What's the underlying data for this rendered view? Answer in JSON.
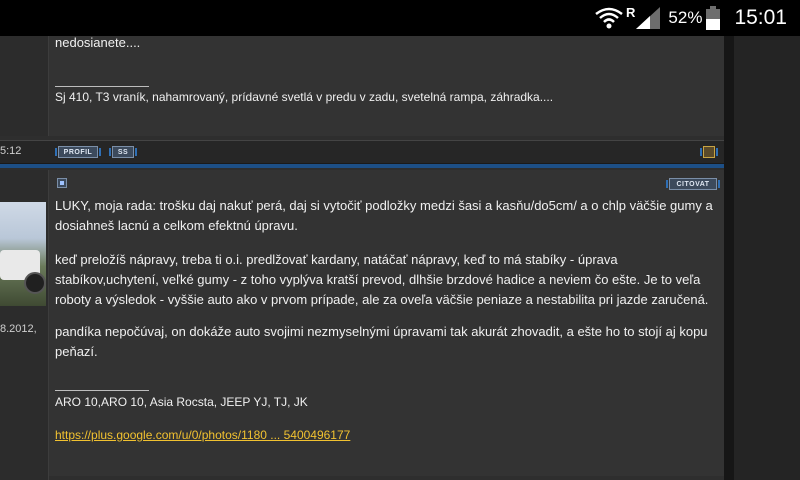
{
  "status_bar": {
    "roaming_indicator": "R",
    "battery_percent": "52%",
    "time": "15:01",
    "icons": [
      "wifi-icon",
      "signal-icon",
      "battery-icon"
    ]
  },
  "post1": {
    "text_tail": "nedosianete....",
    "signature": "Sj 410, T3 vraník, nahamrovaný, prídavné svetlá v predu v zadu, svetelná rampa, záhradka...."
  },
  "post1_bar": {
    "date_fragment": "5:12",
    "profile_btn": "PROFIL",
    "ss_btn": "SS"
  },
  "post2": {
    "left_date_fragment": "8.2012,",
    "quote_btn": "CITOVAT",
    "paragraph1": "LUKY, moja rada: trošku daj nakuť perá, daj si vytočiť podložky medzi šasi a kasňu/do5cm/ a o chlp väčšie gumy a dosiahneš lacnú a celkom efektnú úpravu.",
    "paragraph2": "keď preložíš nápravy, treba ti o.i. predlžovať kardany, natáčať nápravy, keď to má stabíky - úprava stabíkov,uchytení, veľké gumy - z toho vyplýva kratší prevod, dlhšie brzdové hadice a neviem čo ešte. Je to veľa roboty a výsledok - vyššie auto ako v prvom prípade, ale za oveľa väčšie peniaze a nestabilita pri jazde zaručená.",
    "paragraph3": "pandíka nepočúvaj, on dokáže auto svojimi nezmyselnými úpravami tak akurát zhovadit, a ešte ho to stojí aj kopu peňazí.",
    "signature": "ARO 10,ARO 10, Asia Rocsta, JEEP YJ, TJ, JK",
    "link": "https://plus.google.com/u/0/photos/1180 ... 5400496177"
  }
}
